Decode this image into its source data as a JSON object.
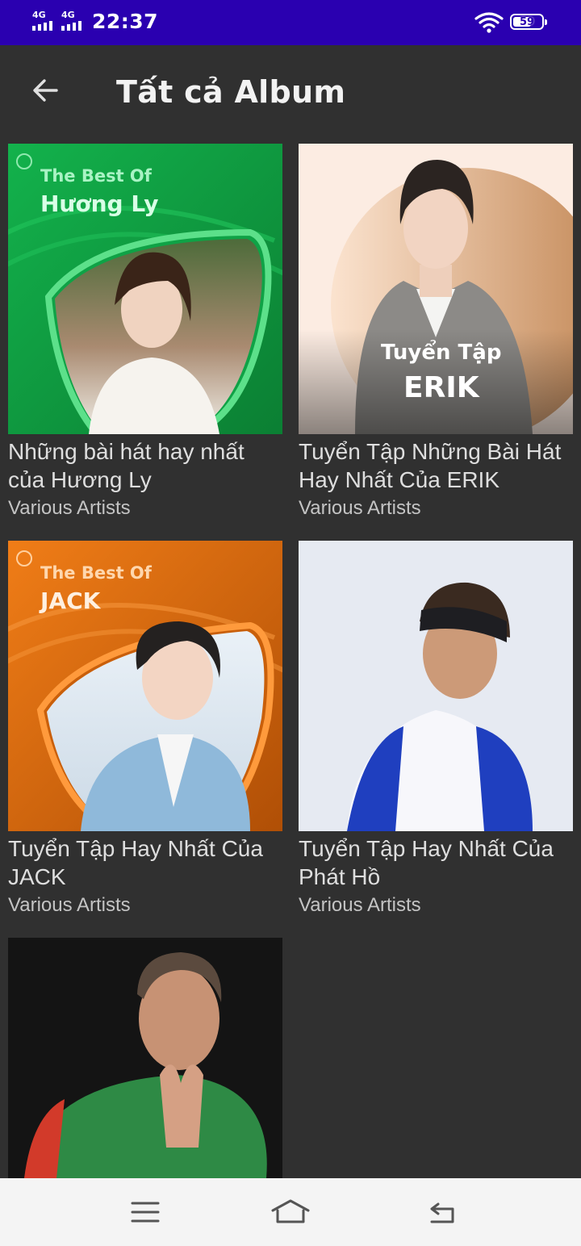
{
  "status_bar": {
    "sim1_label": "4G",
    "sim2_label": "4G",
    "time": "22:37",
    "battery": "59",
    "background": "#2a00b0"
  },
  "app_bar": {
    "back_icon": "arrow-left-icon",
    "title": "Tất cả Album"
  },
  "albums": [
    {
      "title": "Những bài hát hay nhất của Hương Ly",
      "artist": "Various Artists",
      "cover_text_top": "The Best Of",
      "cover_text_main": "Hương Ly",
      "accent": "#1aa84a"
    },
    {
      "title": "Tuyển Tập Những Bài Hát Hay Nhất Của ERIK",
      "artist": "Various Artists",
      "cover_text_top": "Tuyển Tập",
      "cover_text_main": "ERIK",
      "accent": "#d9a276"
    },
    {
      "title": "Tuyển Tập Hay Nhất Của JACK",
      "artist": "Various Artists",
      "cover_text_top": "The Best Of",
      "cover_text_main": "JACK",
      "accent": "#e06a0c"
    },
    {
      "title": "Tuyển Tập Hay Nhất Của Phát Hồ",
      "artist": "Various Artists",
      "accent": "#e4e8f0"
    },
    {
      "title": "",
      "artist": "",
      "accent": "#111111"
    }
  ],
  "nav_bar": {
    "menu_icon": "menu-icon",
    "home_icon": "home-icon",
    "back_icon": "back-icon"
  }
}
